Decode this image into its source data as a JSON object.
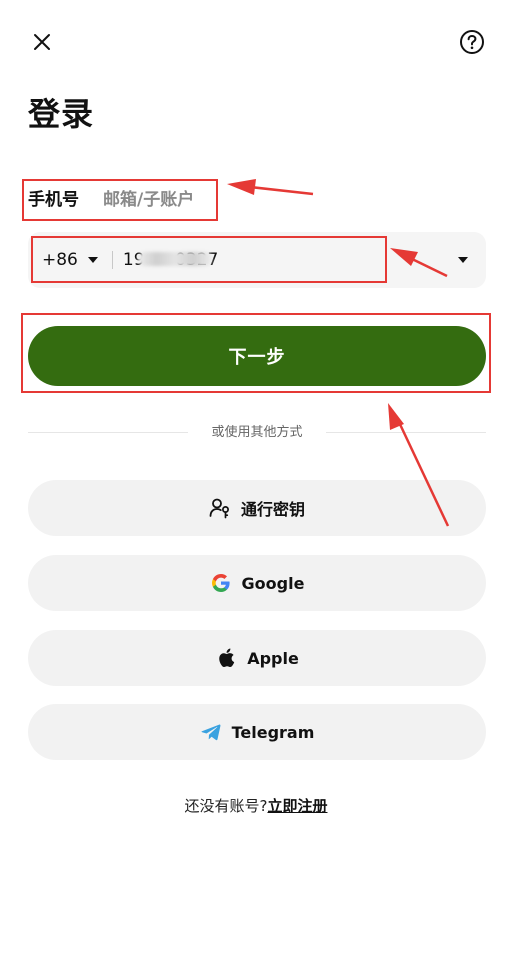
{
  "header": {
    "close_icon": "close-icon",
    "help_icon": "help-circle-icon"
  },
  "title": "登录",
  "tabs": [
    {
      "label": "手机号",
      "active": true
    },
    {
      "label": "邮箱/子账户",
      "active": false
    }
  ],
  "phone": {
    "country_code": "+86",
    "value": "19         0327"
  },
  "next_button": "下一步",
  "or_divider": "或使用其他方式",
  "alt_logins": [
    {
      "label": "通行密钥",
      "icon": "passkey-icon"
    },
    {
      "label": "Google",
      "icon": "google-icon"
    },
    {
      "label": "Apple",
      "icon": "apple-icon"
    },
    {
      "label": "Telegram",
      "icon": "telegram-icon"
    }
  ],
  "register": {
    "prompt": "还没有账号?",
    "link": "立即注册"
  },
  "colors": {
    "primary": "#346c10",
    "annotation": "#e53935",
    "button_bg": "#f2f2f2"
  }
}
